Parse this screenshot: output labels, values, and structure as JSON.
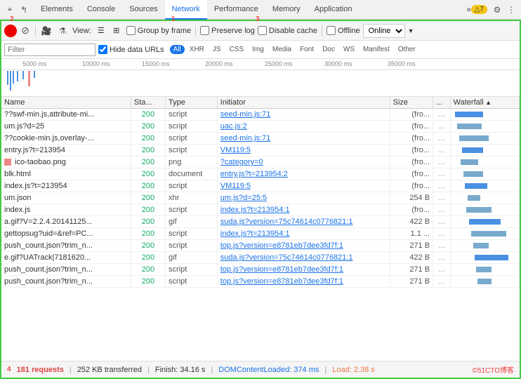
{
  "tabs": {
    "items": [
      {
        "label": "Elements",
        "active": false
      },
      {
        "label": "Console",
        "active": false
      },
      {
        "label": "Sources",
        "active": false
      },
      {
        "label": "Network",
        "active": true
      },
      {
        "label": "Performance",
        "active": false
      },
      {
        "label": "Memory",
        "active": false
      },
      {
        "label": "Application",
        "active": false
      }
    ],
    "more_label": "»",
    "warning_count": "△7"
  },
  "toolbar": {
    "record_title": "Record",
    "clear_title": "Clear",
    "camera_title": "Screenshot",
    "filter_title": "Filter",
    "view_label": "View:",
    "group_by_frame_label": "Group by frame",
    "preserve_log_label": "Preserve log",
    "disable_cache_label": "Disable cache",
    "offline_label": "Offline",
    "online_label": "Online"
  },
  "filter_row": {
    "placeholder": "Filter",
    "hide_data_label": "Hide data URLs",
    "all_label": "All",
    "types": [
      "XHR",
      "JS",
      "CSS",
      "Img",
      "Media",
      "Font",
      "Doc",
      "WS",
      "Manifest",
      "Other"
    ]
  },
  "timeline": {
    "marks": [
      "5000 ms",
      "10000 ms",
      "15000 ms",
      "20000 ms",
      "25000 ms",
      "30000 ms",
      "35000 ms"
    ]
  },
  "table": {
    "headers": [
      "Name",
      "Sta...",
      "Type",
      "Initiator",
      "Size",
      "...",
      "Waterfall"
    ],
    "rows": [
      {
        "name": "??swf-min.js,attribute-mi...",
        "status": "200",
        "type": "script",
        "initiator": "seed-min.js:71",
        "size": "(fro...",
        "more": "..."
      },
      {
        "name": "um.js?d=25",
        "status": "200",
        "type": "script",
        "initiator": "uac.js:2",
        "size": "(fro...",
        "more": "..."
      },
      {
        "name": "??cookie-min.js,overlay-...",
        "status": "200",
        "type": "script",
        "initiator": "seed-min.js:71",
        "size": "(fro...",
        "more": "..."
      },
      {
        "name": "entry.js?t=213954",
        "status": "200",
        "type": "script",
        "initiator": "VM119:5",
        "size": "(fro...",
        "more": "..."
      },
      {
        "name": "ico-taobao.png",
        "status": "200",
        "type": "png",
        "initiator": "?category=0",
        "size": "(fro...",
        "more": "...",
        "is_img": true
      },
      {
        "name": "blk.html",
        "status": "200",
        "type": "document",
        "initiator": "entry.js?t=213954:2",
        "size": "(fro...",
        "more": "..."
      },
      {
        "name": "index.js?t=213954",
        "status": "200",
        "type": "script",
        "initiator": "VM119:5",
        "size": "(fro...",
        "more": "..."
      },
      {
        "name": "um.json",
        "status": "200",
        "type": "xhr",
        "initiator": "um.js?d=25:5",
        "size": "254 B",
        "more": "..."
      },
      {
        "name": "index.js",
        "status": "200",
        "type": "script",
        "initiator": "index.js?t=213954:1",
        "size": "(fro...",
        "more": "..."
      },
      {
        "name": "a.gif?V=2.2.4.20141125...",
        "status": "200",
        "type": "gif",
        "initiator": "suda.js?version=75c74614c0776821:1",
        "size": "422 B",
        "more": "..."
      },
      {
        "name": "gettopsug?uid=&ref=PC...",
        "status": "200",
        "type": "script",
        "initiator": "index.js?t=213954:1",
        "size": "1.1 ...",
        "more": "..."
      },
      {
        "name": "push_count.json?trim_n...",
        "status": "200",
        "type": "script",
        "initiator": "top.js?version=e8781eb7dee3fd7f:1",
        "size": "271 B",
        "more": "..."
      },
      {
        "name": "e.gif?UATrack|7181620...",
        "status": "200",
        "type": "gif",
        "initiator": "suda.js?version=75c74614c0776821:1",
        "size": "422 B",
        "more": "..."
      },
      {
        "name": "push_count.json?trim_n...",
        "status": "200",
        "type": "script",
        "initiator": "top.js?version=e8781eb7dee3fd7f:1",
        "size": "271 B",
        "more": "..."
      },
      {
        "name": "push_count.json?trim_n...",
        "status": "200",
        "type": "script",
        "initiator": "top.js?version=e8781eb7dee3fd7f:1",
        "size": "271 B",
        "more": "..."
      }
    ]
  },
  "status_bar": {
    "requests": "181 requests",
    "transferred": "252 KB transferred",
    "finish": "Finish: 34.16 s",
    "domcontent": "DOMContentLoaded: 374 ms",
    "load": "Load: 2.38 s",
    "watermark": "©51CTO博客"
  },
  "badges": {
    "b1": "1",
    "b2": "2",
    "b3": "3",
    "b4": "4"
  }
}
